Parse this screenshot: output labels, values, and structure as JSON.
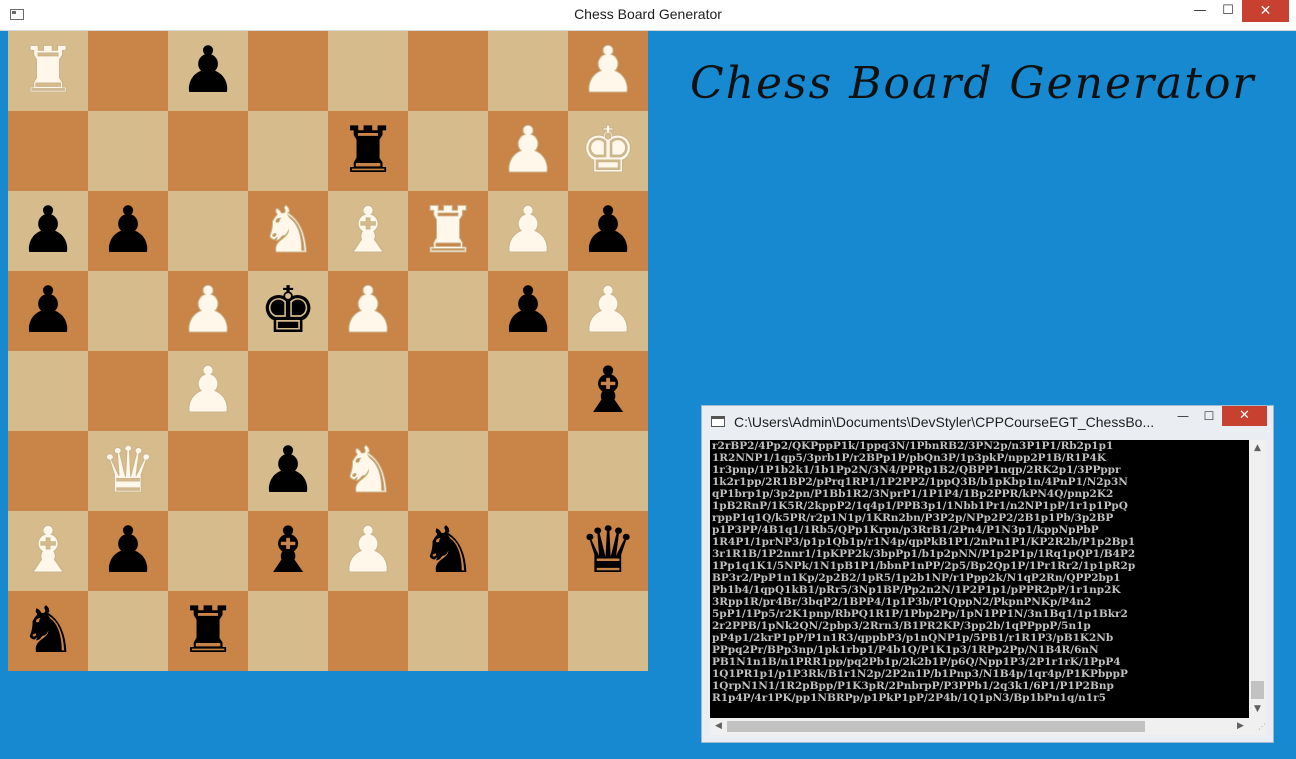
{
  "window": {
    "title": "Chess Board Generator",
    "controls": {
      "minimize": "—",
      "maximize": "☐",
      "close": "✕"
    }
  },
  "heading": "Chess Board Generator",
  "colors": {
    "light_square": "#d6bb8d",
    "dark_square": "#c98447",
    "background": "#1689d1",
    "white_piece": "#fff8ea",
    "black_piece": "#000000"
  },
  "board": {
    "rows": [
      [
        "R",
        "",
        "p",
        "",
        "",
        "",
        "",
        "P"
      ],
      [
        "",
        "",
        "",
        "",
        "r",
        "",
        "P",
        "K"
      ],
      [
        "p",
        "p",
        "",
        "N",
        "B",
        "R",
        "P",
        "p"
      ],
      [
        "p",
        "",
        "P",
        "k",
        "P",
        "",
        "p",
        "P"
      ],
      [
        "",
        "",
        "P",
        "",
        "",
        "",
        "",
        "b"
      ],
      [
        "",
        "Q",
        "",
        "p",
        "N",
        "",
        "",
        ""
      ],
      [
        "B",
        "p",
        "",
        "b",
        "P",
        "n",
        "",
        "q"
      ],
      [
        "n",
        "",
        "r",
        "",
        "",
        "",
        "",
        ""
      ]
    ]
  },
  "console": {
    "title": "C:\\Users\\Admin\\Documents\\DevStyler\\CPPCourseEGT_ChessBo...",
    "controls": {
      "minimize": "—",
      "maximize": "☐",
      "close": "✕"
    },
    "lines": [
      "r2rBP2/4Pp2/QKPppP1k/1ppq3N/1PbnRB2/3PN2p/n3P1P1/Rb2p1p1",
      "1R2NNP1/1qp5/3prb1P/r2BPp1P/pbQn3P/1p3pkP/npp2P1B/R1P4K",
      "1r3pnp/1P1b2k1/1b1Pp2N/3N4/PPRp1B2/QBPP1nqp/2RK2p1/3PPppr",
      "1k2r1pp/2R1BP2/pPrq1RP1/1P2PP2/1ppQ3B/b1pKbp1n/4PnP1/N2p3N",
      "qP1brp1p/3p2pn/P1Bb1R2/3NprP1/1P1P4/1Bp2PPR/kPN4Q/pnp2K2",
      "1pB2RnP/1K5R/2kppP2/1q4p1/PPB3p1/1Nbb1Pr1/n2NP1pP/1r1p1PpQ",
      "rppP1q1Q/k5PR/r2p1N1p/1KRn2bn/P3P2p/NPp2P2/2B1p1Pb/3p2BP",
      "p1P3PP/4B1q1/1Rb5/QPp1Krpn/p3RrB1/2Pn4/P1N3p1/kppNpPbP",
      "1R4P1/1prNP3/p1p1Qb1p/r1N4p/qpPkB1P1/2nPn1P1/KP2R2b/P1p2Bp1",
      "3r1R1B/1P2nnr1/1pKPP2k/3bpPp1/b1p2pNN/P1p2P1p/1Rq1pQP1/B4P2",
      "1Pp1q1K1/5NPk/1N1pB1P1/bbnP1nPP/2p5/Bp2Qp1P/1Pr1Rr2/1p1pR2p",
      "BP3r2/PpP1n1Kp/2p2B2/1pR5/1p2b1NP/r1Ppp2k/N1qP2Rn/QPP2bp1",
      "Pb1b4/1qpQ1kB1/pRr5/3Np1BP/Pp2n2N/1P2P1p1/pPPR2pP/1r1np2K",
      "3Rpp1R/pr4Br/3bqP2/1BPP4/1p1P3b/P1QppN2/PkpnPNKp/P4n2",
      "5pP1/1Pp5/r2K1pnp/RbPQ1R1P/1Pbp2Pp/1pN1PP1N/3n1Bq1/1p1Bkr2",
      "2r2PPB/1pNk2QN/2pbp3/2Rrn3/B1PR2KP/3pp2b/1qPPppP/5n1p",
      "pP4p1/2krP1pP/P1n1R3/qppbP3/p1nQNP1p/5PB1/r1R1P3/pB1K2Nb",
      "PPpq2Pr/BPp3np/1pk1rbp1/P4b1Q/P1K1p3/1RPp2Pp/N1B4R/6nN",
      "PB1N1n1B/n1PRR1pp/pq2Pb1p/2k2b1P/p6Q/Npp1P3/2P1r1rK/1PpP4",
      "1Q1PR1p1/p1P3Rk/B1r1N2p/2P2n1P/b1Pnp3/N1B4p/1qr4p/P1KPbppP",
      "1QrpN1N1/1R2pBpp/P1K3pR/2PnbrpP/P3PPb1/2q3k1/6P1/P1P2Bnp",
      "R1p4P/4r1PK/pp1NBRPp/p1PkP1pP/2P4b/1Q1pN3/Bp1bPn1q/n1r5"
    ]
  }
}
